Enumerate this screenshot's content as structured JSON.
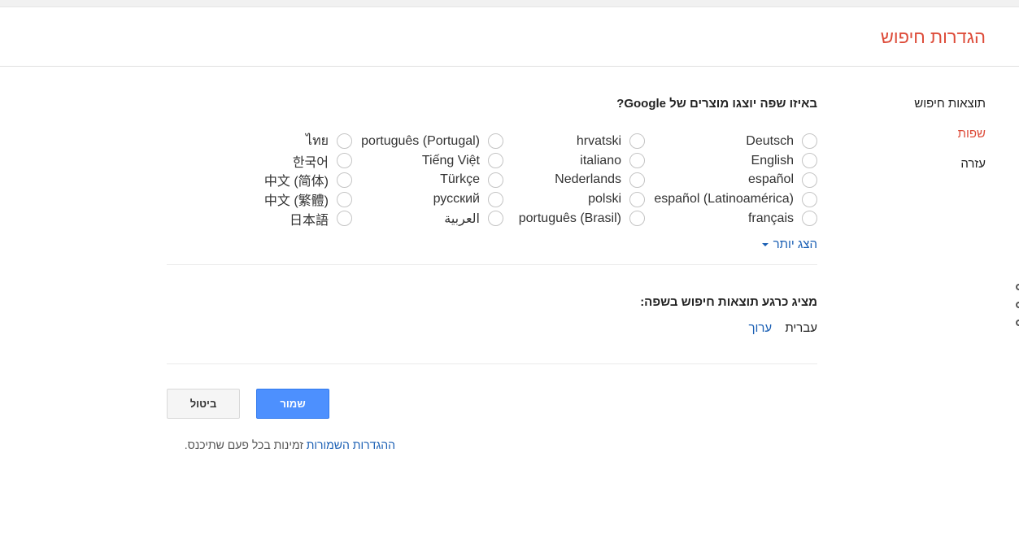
{
  "header": {
    "title": "הגדרות חיפוש"
  },
  "sidebar": {
    "items": [
      {
        "label": "תוצאות חיפוש"
      },
      {
        "label": "שפות"
      },
      {
        "label": "עזרה"
      }
    ]
  },
  "languages": {
    "question": "באיזו שפה יוצגו מוצרים של Google?",
    "columns": [
      [
        "Deutsch",
        "English",
        "español",
        "español (Latinoamérica)",
        "français"
      ],
      [
        "hrvatski",
        "italiano",
        "Nederlands",
        "polski",
        "português (Brasil)"
      ],
      [
        "português (Portugal)",
        "Tiếng Việt",
        "Türkçe",
        "русский",
        "العربية"
      ],
      [
        "ไทย",
        "한국어",
        "中文 (简体)",
        "中文 (繁體)",
        "日本語"
      ]
    ],
    "show_more": "הצג יותר"
  },
  "results_language": {
    "title": "מציג כרגע תוצאות חיפוש בשפה:",
    "current": "עברית",
    "edit": "ערוך"
  },
  "buttons": {
    "save": "שמור",
    "cancel": "ביטול"
  },
  "footnote": {
    "link": "ההגדרות השמורות",
    "text": " זמינות בכל פעם שתיכנס."
  }
}
